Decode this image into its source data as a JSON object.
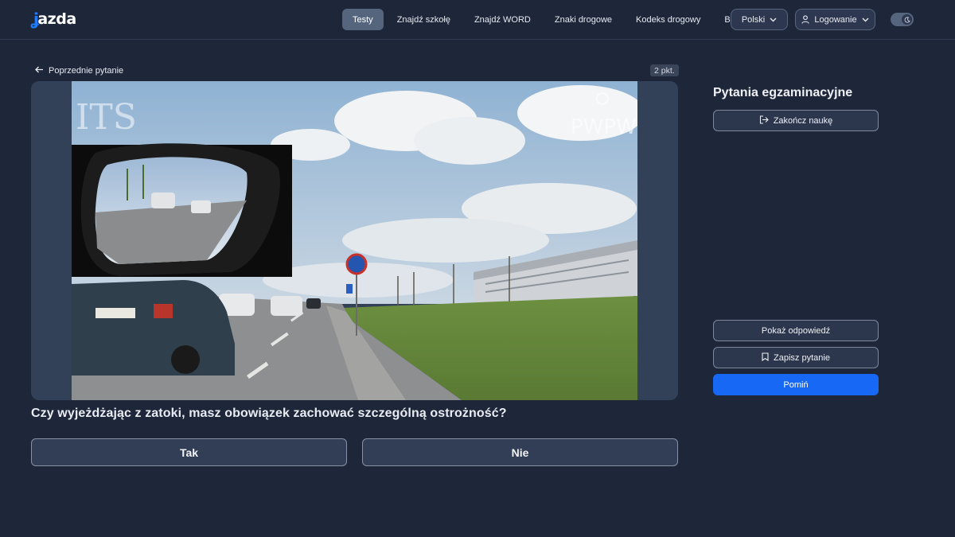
{
  "header": {
    "logo_text": "Jazda",
    "nav": [
      {
        "label": "Testy",
        "active": true
      },
      {
        "label": "Znajdź szkołę",
        "active": false
      },
      {
        "label": "Znajdź WORD",
        "active": false
      },
      {
        "label": "Znaki drogowe",
        "active": false
      },
      {
        "label": "Kodeks drogowy",
        "active": false
      },
      {
        "label": "Blog",
        "active": false
      }
    ],
    "language": "Polski",
    "login": "Logowanie",
    "theme_icon": "moon-icon"
  },
  "question": {
    "prev_label": "Poprzednie pytanie",
    "points": "2 pkt.",
    "watermark_left": "ITS",
    "watermark_right": "PWPW",
    "text": "Czy wyjeżdżając z zatoki, masz obowiązek zachować szczególną ostrożność?",
    "answers": [
      "Tak",
      "Nie"
    ]
  },
  "sidebar": {
    "title": "Pytania egzaminacyjne",
    "end_label": "Zakończ naukę",
    "show_answer_label": "Pokaż odpowiedź",
    "save_label": "Zapisz pytanie",
    "skip_label": "Pomiń"
  },
  "colors": {
    "background": "#1e2639",
    "accent": "#1768f5",
    "card": "#334158"
  }
}
